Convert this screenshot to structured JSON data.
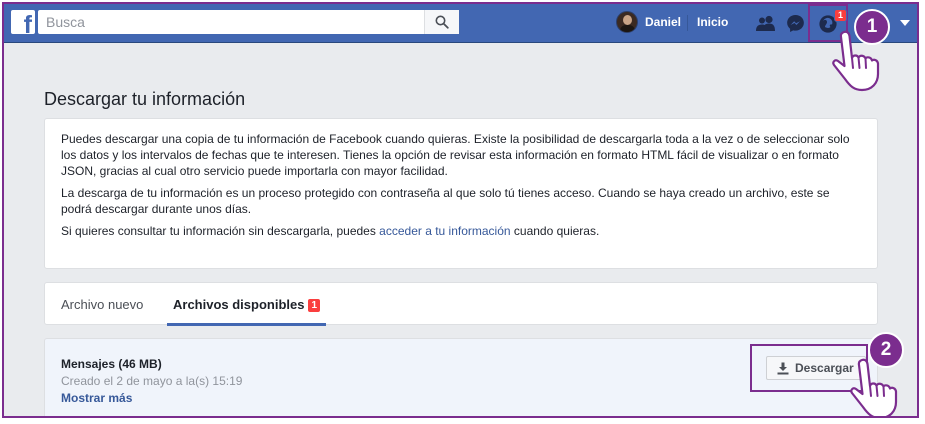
{
  "topbar": {
    "logo_letter": "f",
    "search_placeholder": "Busca",
    "user_name": "Daniel",
    "home_label": "Inicio",
    "notifications_count": "1",
    "icons": [
      "search-icon",
      "friend-requests-icon",
      "messenger-icon",
      "notifications-icon",
      "account-menu-caret-icon"
    ]
  },
  "steps": {
    "one": "1",
    "two": "2"
  },
  "page": {
    "title": "Descargar tu información",
    "paragraph1": "Puedes descargar una copia de tu información de Facebook cuando quieras. Existe la posibilidad de descargarla toda a la vez o de seleccionar solo los datos y los intervalos de fechas que te interesen. Tienes la opción de revisar esta información en formato HTML fácil de visualizar o en formato JSON, gracias al cual otro servicio puede importarla con mayor facilidad.",
    "paragraph2": "La descarga de tu información es un proceso protegido con contraseña al que solo tú tienes acceso. Cuando se haya creado un archivo, este se podrá descargar durante unos días.",
    "paragraph3_before": "Si quieres consultar tu información sin descargarla, puedes ",
    "paragraph3_link": "acceder a tu información",
    "paragraph3_after": " cuando quieras."
  },
  "tabs": {
    "new_file": "Archivo nuevo",
    "available_files": "Archivos disponibles",
    "available_badge": "1"
  },
  "file": {
    "name": "Mensajes (46 MB)",
    "created": "Creado el 2 de mayo a la(s) 15:19",
    "show_more": "Mostrar más",
    "download_label": "Descargar"
  },
  "colors": {
    "brand": "#4267b2",
    "highlight": "#7b2d8e",
    "badge": "#fa3e3e",
    "link": "#365899"
  }
}
